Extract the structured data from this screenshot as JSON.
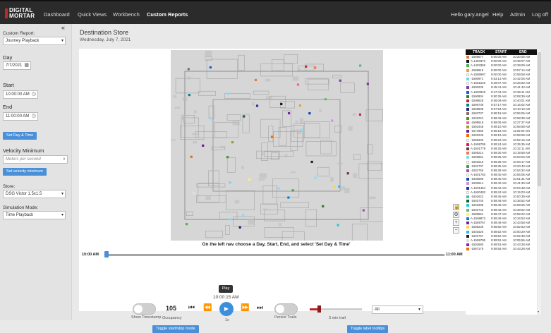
{
  "brand": {
    "line1": "DIGITAL",
    "line2": "MORTAR",
    "accent": "#c0292a"
  },
  "nav": {
    "items": [
      {
        "label": "Dashboard"
      },
      {
        "label": "Quick Views"
      },
      {
        "label": "Workbench"
      },
      {
        "label": "Custom Reports"
      }
    ],
    "active": "Custom Reports",
    "greeting": "Hello gary.angel",
    "help": "Help",
    "admin": "Admin",
    "logoff": "Log off"
  },
  "sidebar": {
    "collapse_icon": "double-chevron-left",
    "custom_report_label": "Custom Report:",
    "custom_report_value": "Journey Playback",
    "day_label": "Day",
    "day_value": "7/7/2021",
    "start_label": "Start",
    "start_value": "10:00:00 AM",
    "end_label": "End",
    "end_value": "11:00:00 AM",
    "set_day_button": "Set Day & Time",
    "velocity_label": "Velocity Minimum",
    "velocity_placeholder": "Meters per second",
    "set_velocity_button": "Set velocity minimum",
    "store_label": "Store:",
    "store_value": "DSG Victor 1.5x1.5",
    "sim_label": "Simulation Mode:",
    "sim_value": "Time Playback"
  },
  "page": {
    "title": "Destination Store",
    "date": "Wednesday, July 7, 2021",
    "instruction": "On the left nav choose a Day, Start, End, and select 'Set Day & Time'"
  },
  "timeline": {
    "start_label": "10:00 AM",
    "end_label": "11:00 AM",
    "current_time": "10:00:15 AM",
    "tooltip": "Play",
    "position_fraction": 0.0
  },
  "controls": {
    "show_timestamp_label": "Show Timestamp",
    "occupancy_value": "105",
    "occupancy_label": "Occupancy",
    "speed_label": "1x",
    "persist_trails_label": "Persist Trails",
    "trail_label": "3 min trail",
    "trail_fraction": 0.18,
    "filter_value": "All",
    "toggle_start_stop": "Toggle start/stop mode",
    "toggle_tooltips": "Toggle label tooltips",
    "accent": "#3b8fdc"
  },
  "tracks_header": {
    "track": "TRACK",
    "start": "START",
    "end": "END"
  },
  "tracks": [
    {
      "id": "-1598677",
      "start": "9:00:00 AM",
      "end": "10:20:05 AM",
      "color": "#e07b39"
    },
    {
      "id": "A-1483372",
      "start": "9:00:00 AM",
      "end": "10:39:07 AM",
      "color": "#111111"
    },
    {
      "id": "A-1483359",
      "start": "9:00:00 AM",
      "end": "10:39:09 AM",
      "color": "#4caf50"
    },
    {
      "id": "-1586818",
      "start": "9:00:00 AM",
      "end": "10:57:14 AM",
      "color": "#e6a23c"
    },
    {
      "id": "A-1586997",
      "start": "9:00:00 AM",
      "end": "10:59:58 AM",
      "color": "#ffffff"
    },
    {
      "id": "-1590971",
      "start": "9:53:14 AM",
      "end": "10:42:06 AM",
      "color": "#6fd6f0"
    },
    {
      "id": "A-1581526",
      "start": "9:29:07 AM",
      "end": "10:26:50 AM",
      "color": "#ffffff"
    },
    {
      "id": "-1600236",
      "start": "9:45:41 AM",
      "end": "10:41:43 AM",
      "color": "#7b3fa0"
    },
    {
      "id": "A-1600949",
      "start": "9:47:44 AM",
      "end": "10:39:11 AM",
      "color": "#1565c0"
    },
    {
      "id": "-1590904",
      "start": "9:50:36 AM",
      "end": "10:08:39 AM",
      "color": "#2e7d32"
    },
    {
      "id": "-1598628",
      "start": "9:55:09 AM",
      "end": "10:40:01 AM",
      "color": "#c62828"
    },
    {
      "id": "-1596739",
      "start": "9:57:17 AM",
      "end": "10:15:02 AM",
      "color": "#00838f"
    },
    {
      "id": "-1598608",
      "start": "9:57:53 AM",
      "end": "10:10:10 AM",
      "color": "#1a237e"
    },
    {
      "id": "-1583737",
      "start": "9:58:19 AM",
      "end": "10:56:06 AM",
      "color": "#8d6e63"
    },
    {
      "id": "-1601021",
      "start": "9:58:46 AM",
      "end": "10:08:39 AM",
      "color": "#558b2f"
    },
    {
      "id": "-1599618",
      "start": "9:59:09 AM",
      "end": "10:27:37 AM",
      "color": "#f06292"
    },
    {
      "id": "-1592448",
      "start": "9:59:10 AM",
      "end": "10:59:58 AM",
      "color": "#9e9d24"
    },
    {
      "id": "-1574956",
      "start": "9:59:19 AM",
      "end": "11:00:00 AM",
      "color": "#6a1b9a"
    },
    {
      "id": "-1602235",
      "start": "9:59:19 AM",
      "end": "10:59:58 AM",
      "color": "#ef6c00"
    },
    {
      "id": "-1595203",
      "start": "9:59:22 AM",
      "end": "10:52:16 AM",
      "color": "#ffffff"
    },
    {
      "id": "A-1599795",
      "start": "9:59:24 AM",
      "end": "10:35:35 AM",
      "color": "#d81b60"
    },
    {
      "id": "A-1601779",
      "start": "9:59:25 AM",
      "end": "10:32:11 AM",
      "color": "#5d4037"
    },
    {
      "id": "-1595214",
      "start": "9:59:30 AM",
      "end": "10:19:58 AM",
      "color": "#ff7043"
    },
    {
      "id": "-1600951",
      "start": "9:59:35 AM",
      "end": "10:03:03 AM",
      "color": "#80deea"
    },
    {
      "id": "-1601619",
      "start": "9:59:35 AM",
      "end": "10:03:17 AM",
      "color": "#ffffff"
    },
    {
      "id": "-1601707",
      "start": "9:59:36 AM",
      "end": "10:20:40 AM",
      "color": "#43a047"
    },
    {
      "id": "-1601756",
      "start": "9:59:38 AM",
      "end": "10:04:32 AM",
      "color": "#ab47bc"
    },
    {
      "id": "A-1601783",
      "start": "9:59:40 AM",
      "end": "10:06:06 AM",
      "color": "#ffffff"
    },
    {
      "id": "-1600596",
      "start": "9:59:40 AM",
      "end": "10:01:31 AM",
      "color": "#0d47a1"
    },
    {
      "id": "-1600614",
      "start": "9:59:40 AM",
      "end": "10:41:30 AM",
      "color": "#ce93d8"
    },
    {
      "id": "A-1601454",
      "start": "9:59:42 AM",
      "end": "10:04:48 AM",
      "color": "#283593"
    },
    {
      "id": "A-1600483",
      "start": "9:59:42 AM",
      "end": "10:15:03 AM",
      "color": "#ffffff"
    },
    {
      "id": "-1601622",
      "start": "9:59:46 AM",
      "end": "10:00:39 AM",
      "color": "#4db6ac"
    },
    {
      "id": "-1602740",
      "start": "9:59:46 AM",
      "end": "10:38:52 AM",
      "color": "#1b5e20"
    },
    {
      "id": "-1601995",
      "start": "9:59:46 AM",
      "end": "10:59:05 AM",
      "color": "#26c6da"
    },
    {
      "id": "-1602743",
      "start": "9:59:46 AM",
      "end": "10:38:52 AM",
      "color": "#66bb6a"
    },
    {
      "id": "-1589651",
      "start": "9:59:47 AM",
      "end": "10:59:22 AM",
      "color": "#fff176"
    },
    {
      "id": "A-1598873",
      "start": "9:59:48 AM",
      "end": "10:34:53 AM",
      "color": "#0288d1"
    },
    {
      "id": "A-1589767",
      "start": "9:59:49 AM",
      "end": "10:43:58 AM",
      "color": "#7b1fa2"
    },
    {
      "id": "-1595239",
      "start": "9:59:50 AM",
      "end": "10:52:53 AM",
      "color": "#fdd835"
    },
    {
      "id": "-1601620",
      "start": "9:59:52 AM",
      "end": "10:00:29 AM",
      "color": "#29b6f6"
    },
    {
      "id": "-1601767",
      "start": "9:59:52 AM",
      "end": "10:02:38 AM",
      "color": "#212121"
    },
    {
      "id": "A-1599795",
      "start": "9:59:52 AM",
      "end": "10:05:56 AM",
      "color": "#e0e0e0"
    },
    {
      "id": "-1592680",
      "start": "9:59:53 AM",
      "end": "10:43:28 AM",
      "color": "#8e24aa"
    },
    {
      "id": "-1597176",
      "start": "9:59:55 AM",
      "end": "10:43:28 AM",
      "color": "#ef6c00"
    }
  ],
  "map": {
    "zoom_in": "+",
    "zoom_out": "−",
    "lock_icon": "lock-icon",
    "gear_icon": "gear-icon"
  }
}
